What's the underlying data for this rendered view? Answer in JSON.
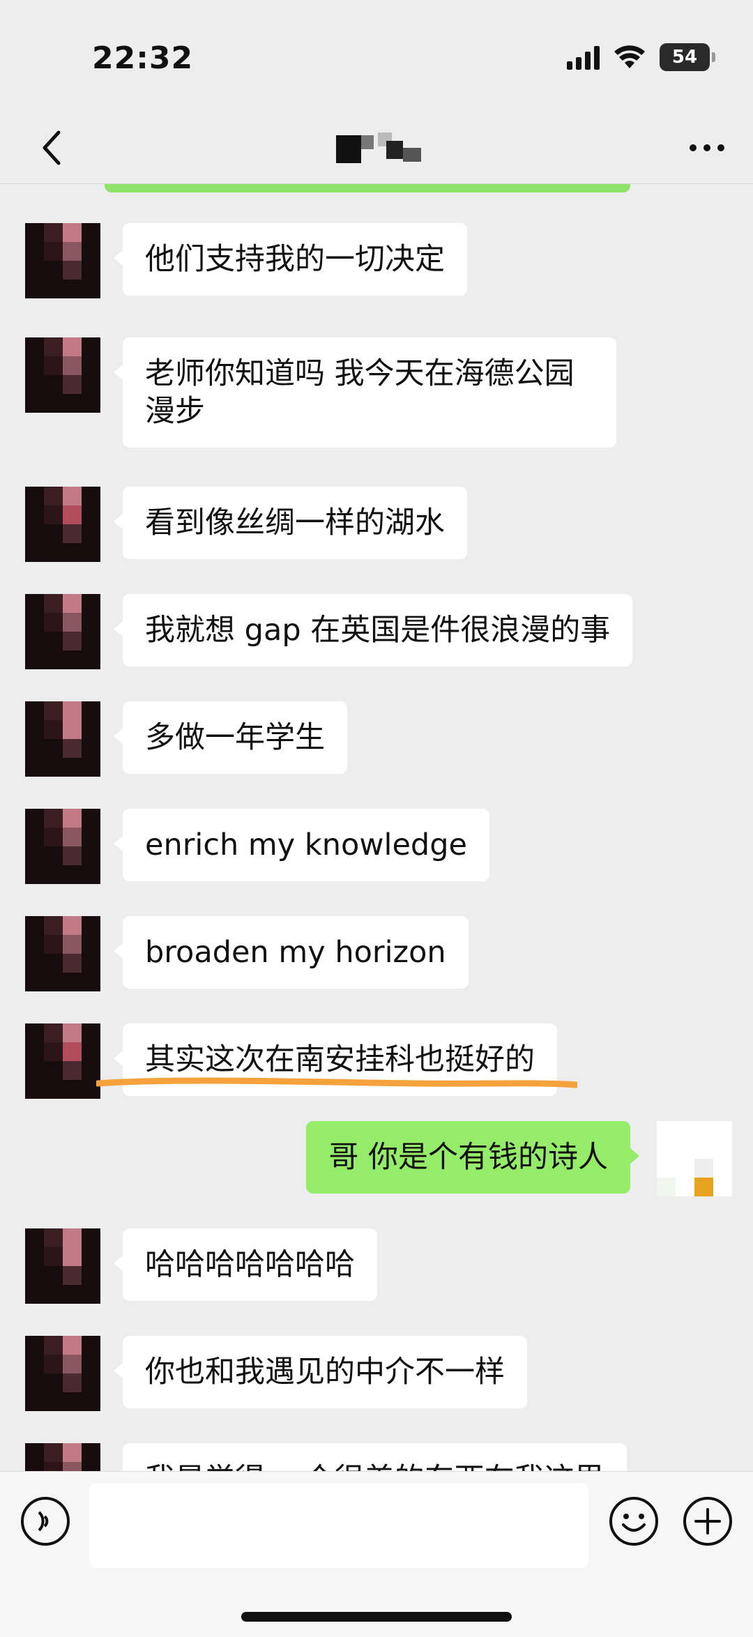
{
  "status_bar": {
    "time": "22:32",
    "battery": "54"
  },
  "header": {
    "title": ""
  },
  "messages": [
    {
      "side": "received",
      "text": "他们支持我的一切决定"
    },
    {
      "side": "received",
      "text": "老师你知道吗 我今天在海德公园漫步"
    },
    {
      "side": "received",
      "text": "看到像丝绸一样的湖水"
    },
    {
      "side": "received",
      "text": "我就想 gap 在英国是件很浪漫的事"
    },
    {
      "side": "received",
      "text": "多做一年学生"
    },
    {
      "side": "received",
      "text": "enrich my knowledge"
    },
    {
      "side": "received",
      "text": "broaden my horizon"
    },
    {
      "side": "received",
      "text": "其实这次在南安挂科也挺好的",
      "highlight_color": "#f5a23c"
    },
    {
      "side": "sent",
      "text": "哥 你是个有钱的诗人"
    },
    {
      "side": "received",
      "text": "哈哈哈哈哈哈哈"
    },
    {
      "side": "received",
      "text": "你也和我遇见的中介不一样"
    },
    {
      "side": "received",
      "text": "我是觉得 一个很美的东西在我这里"
    }
  ],
  "input_bar": {
    "placeholder": ""
  },
  "colors": {
    "sent_bubble": "#95ec69",
    "received_bubble": "#ffffff",
    "background": "#ededed",
    "underline": "#f5a23c"
  }
}
